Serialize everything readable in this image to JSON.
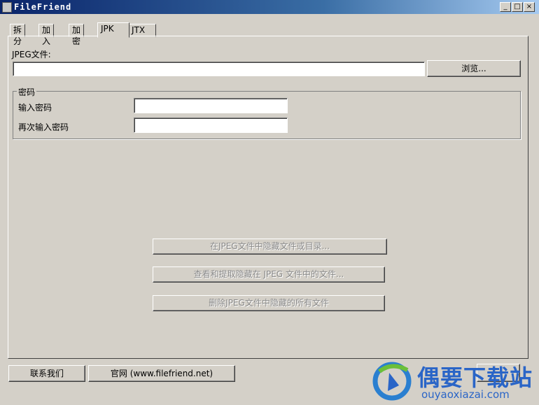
{
  "window": {
    "title": "FileFriend",
    "minimize": "_",
    "maximize": "□",
    "close": "×"
  },
  "tabs": [
    {
      "label": "拆分"
    },
    {
      "label": "加入"
    },
    {
      "label": "加密"
    },
    {
      "label": "JPK",
      "active": true
    },
    {
      "label": "JTX"
    }
  ],
  "jpeg": {
    "label": "JPEG文件:",
    "value": "",
    "browse": "浏览..."
  },
  "password": {
    "group_title": "密码",
    "enter_label": "输入密码",
    "reenter_label": "再次输入密码",
    "enter_value": "",
    "reenter_value": ""
  },
  "actions": {
    "hide": "在JPEG文件中隐藏文件或目录...",
    "view_extract": "查看和提取隐藏在 JPEG 文件中的文件...",
    "delete": "删除JPEG文件中隐藏的所有文件"
  },
  "footer": {
    "contact": "联系我们",
    "website": "官网 (www.filefriend.net)"
  },
  "watermark": {
    "text": "偶要下载站",
    "url": "ouyaoxiazai.com"
  }
}
